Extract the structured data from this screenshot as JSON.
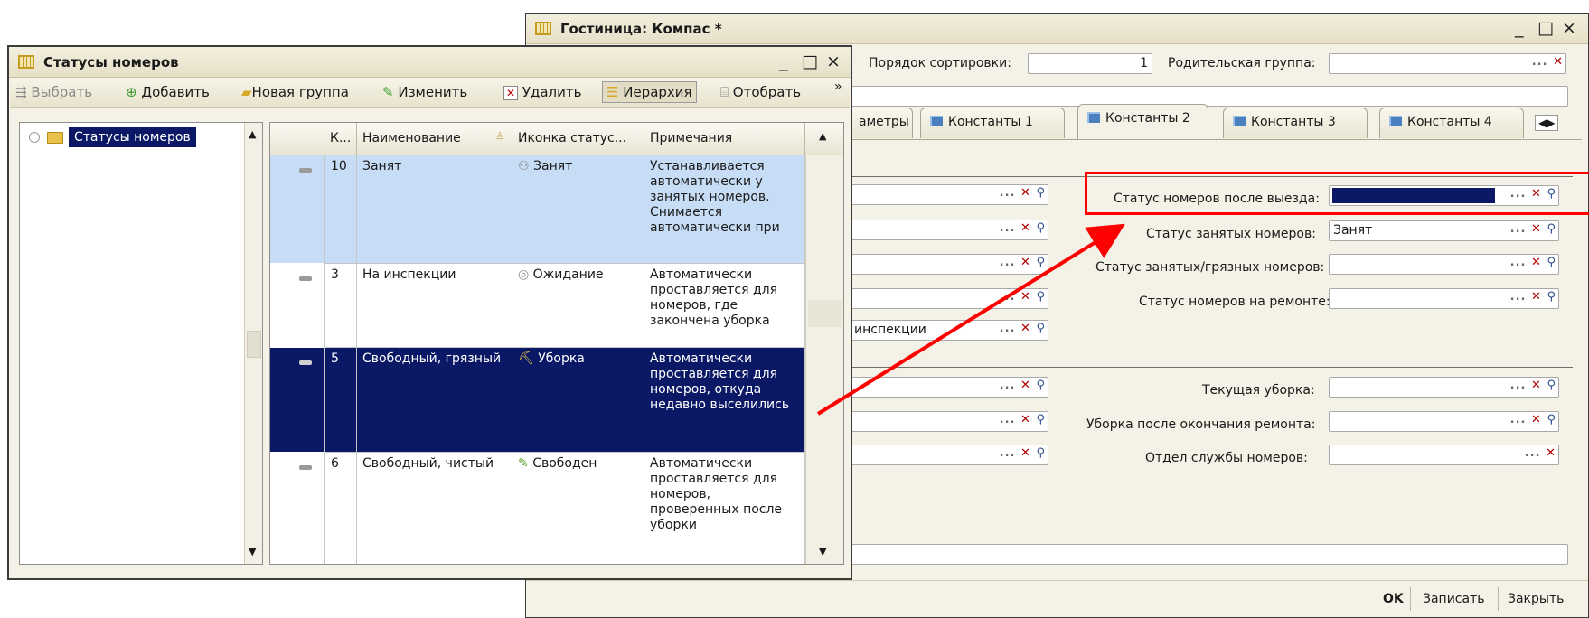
{
  "hotel_window": {
    "title": "Гостиница: Компас *",
    "controls": [
      "_",
      "□",
      "×"
    ],
    "sort_order_label": "Порядок сортировки:",
    "sort_order_value": "1",
    "parent_group_label": "Родительская группа:",
    "tabs": [
      "аметры",
      "Константы 1",
      "Константы 2",
      "Константы 3",
      "Константы 4"
    ],
    "right_fields": [
      {
        "label": "Статус номеров после выезда:",
        "value": ""
      },
      {
        "label": "Статус занятых номеров:",
        "value": "Занят"
      },
      {
        "label": "Статус занятых/грязных номеров:",
        "value": ""
      },
      {
        "label": "Статус номеров на ремонте:",
        "value": ""
      }
    ],
    "left_partial_value": "инспекции",
    "right_fields_2": [
      {
        "label": "Текущая уборка:",
        "value": ""
      },
      {
        "label": "Уборка после окончания ремонта:",
        "value": ""
      },
      {
        "label": "Отдел службы номеров:",
        "value": ""
      }
    ],
    "footer": {
      "ok": "OK",
      "save": "Записать",
      "close": "Закрыть"
    }
  },
  "status_window": {
    "title": "Статусы номеров",
    "controls": [
      "_",
      "□",
      "×"
    ],
    "toolbar": [
      "Выбрать",
      "Добавить",
      "Новая группа",
      "Изменить",
      "Удалить",
      "Иерархия",
      "Отобрать"
    ],
    "tree_root": "Статусы номеров",
    "columns": [
      "К...",
      "Наименование",
      "Иконка статус...",
      "Примечания"
    ],
    "rows": [
      {
        "code": "10",
        "name": "Занят",
        "icon": "Занят",
        "note": "Устанавливается автоматически у занятых номеров. Снимается автоматически при"
      },
      {
        "code": "3",
        "name": "На инспекции",
        "icon": "Ожидание",
        "note": "Автоматически проставляется для номеров, где закончена уборка"
      },
      {
        "code": "5",
        "name": "Свободный, грязный",
        "icon": "Уборка",
        "note": "Автоматически проставляется для номеров, откуда недавно выселились"
      },
      {
        "code": "6",
        "name": "Свободный, чистый",
        "icon": "Свободен",
        "note": "Автоматически проставляется для номеров, проверенных после уборки"
      }
    ]
  },
  "colors": {
    "highlight_red": "#ff0000",
    "selected_row": "#0a1866",
    "first_row": "#c7dcf5"
  }
}
